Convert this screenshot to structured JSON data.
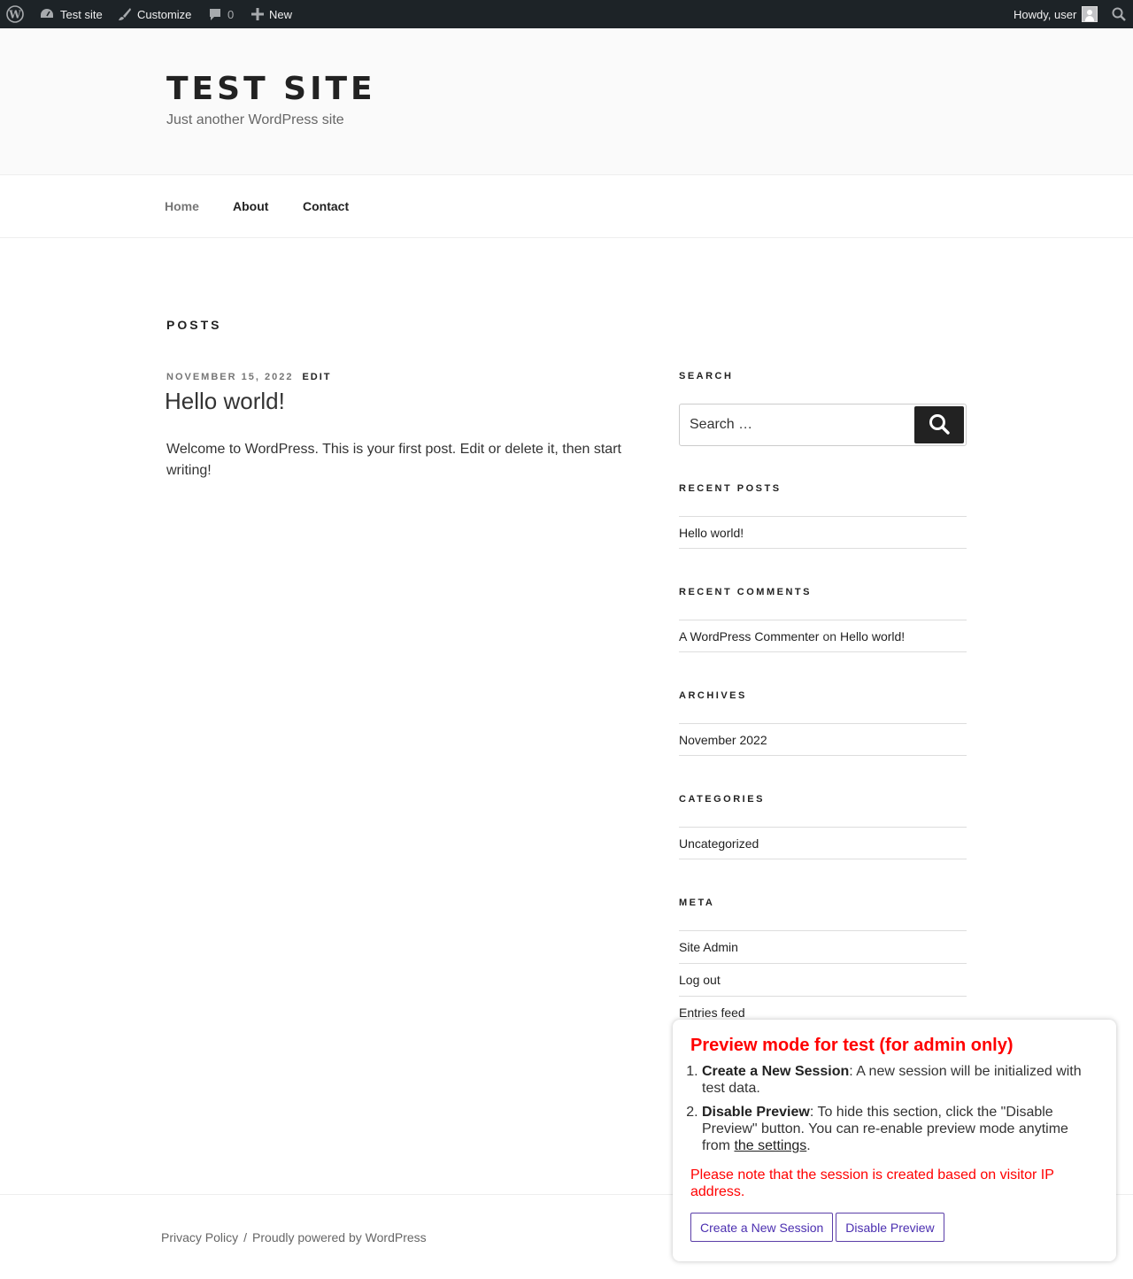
{
  "adminbar": {
    "site_name": "Test site",
    "customize": "Customize",
    "comments_count": "0",
    "new": "New",
    "howdy": "Howdy, user"
  },
  "header": {
    "title": "TEST SITE",
    "description": "Just another WordPress site"
  },
  "nav": {
    "items": [
      {
        "label": "Home"
      },
      {
        "label": "About"
      },
      {
        "label": "Contact"
      }
    ]
  },
  "main": {
    "page_title": "POSTS",
    "post": {
      "date": "NOVEMBER 15, 2022",
      "edit": "EDIT",
      "title": "Hello world!",
      "content": "Welcome to WordPress. This is your first post. Edit or delete it, then start writing!"
    }
  },
  "sidebar": {
    "search": {
      "title": "SEARCH",
      "placeholder": "Search …"
    },
    "recent_posts": {
      "title": "RECENT POSTS",
      "items": [
        "Hello world!"
      ]
    },
    "recent_comments": {
      "title": "RECENT COMMENTS",
      "author": "A WordPress Commenter",
      "on": "on",
      "post": "Hello world!"
    },
    "archives": {
      "title": "ARCHIVES",
      "items": [
        "November 2022"
      ]
    },
    "categories": {
      "title": "CATEGORIES",
      "items": [
        "Uncategorized"
      ]
    },
    "meta": {
      "title": "META",
      "items": [
        "Site Admin",
        "Log out",
        "Entries feed"
      ]
    }
  },
  "footer": {
    "privacy": "Privacy Policy",
    "separator": "/",
    "powered": "Proudly powered by WordPress"
  },
  "preview": {
    "title": "Preview mode for test (for admin only)",
    "item1_bold": "Create a New Session",
    "item1_text": ": A new session will be initialized with test data.",
    "item2_bold": "Disable Preview",
    "item2_text": ": To hide this section, click the \"Disable Preview\" button. You can re-enable preview mode anytime from ",
    "item2_link": "the settings",
    "item2_end": ".",
    "note": "Please note that the session is created based on visitor IP address.",
    "btn_create": "Create a New Session",
    "btn_disable": "Disable Preview"
  }
}
